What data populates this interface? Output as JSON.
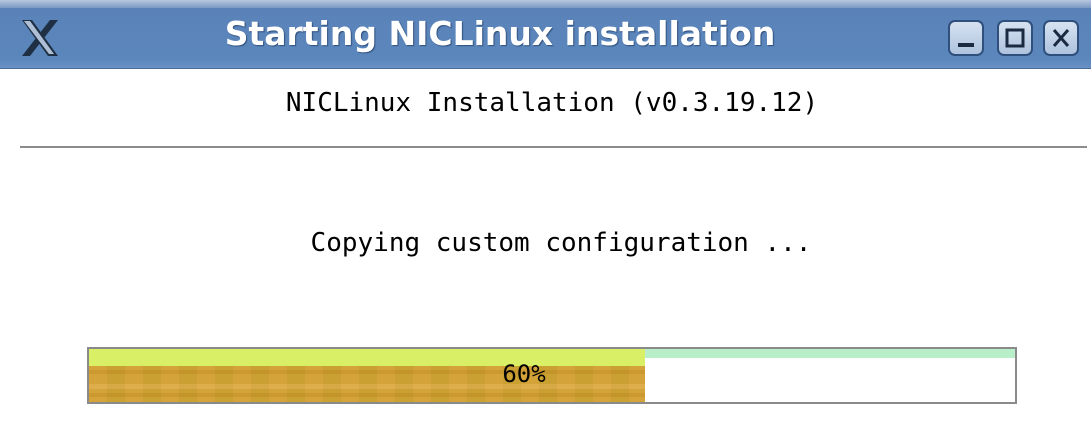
{
  "window": {
    "title": "Starting NICLinux installation",
    "logo_icon": "x-logo-icon",
    "buttons": {
      "minimize_icon": "minimize-icon",
      "maximize_icon": "maximize-icon",
      "close_icon": "close-icon"
    }
  },
  "main": {
    "header": "NICLinux Installation (v0.3.19.12)",
    "status": "Copying custom configuration ...",
    "progress": {
      "percent": 60,
      "label": "60%"
    }
  },
  "colors": {
    "titlebar": "#5b87bd",
    "progress_fill_top": "#d8ef66",
    "progress_fill": "#d4a43a",
    "progress_track_top": "#b8efc8",
    "separator": "#8c8c8c"
  }
}
